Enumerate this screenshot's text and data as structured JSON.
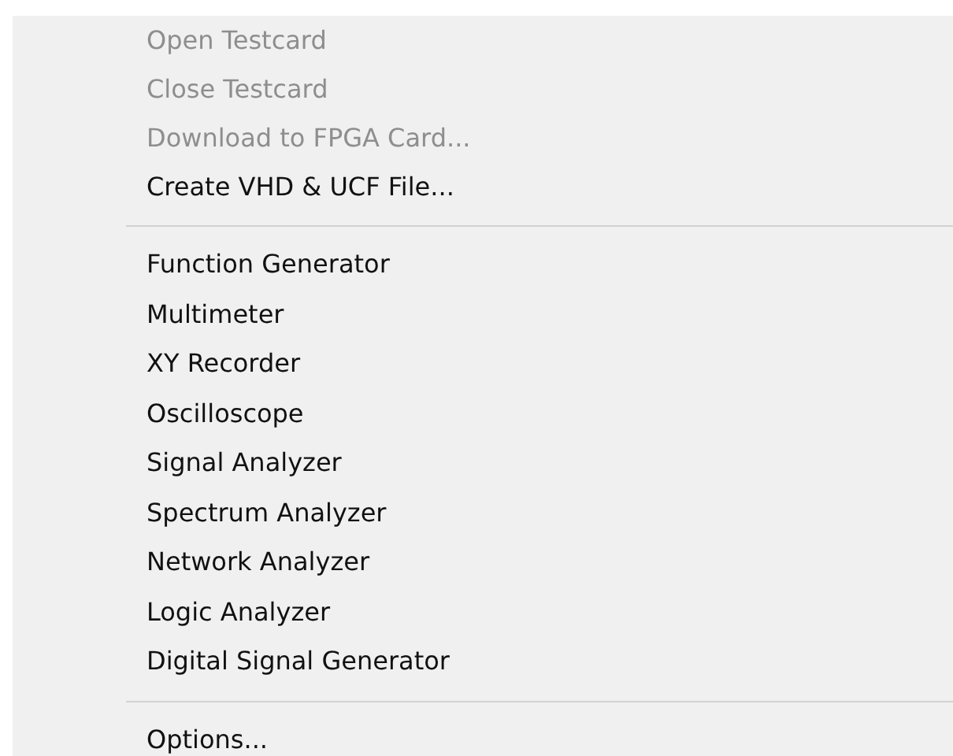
{
  "menu": {
    "groups": [
      {
        "items": [
          {
            "label": "Open Testcard",
            "disabled": true
          },
          {
            "label": "Close Testcard",
            "disabled": true
          },
          {
            "label": "Download to FPGA Card...",
            "disabled": true
          },
          {
            "label": "Create VHD & UCF File...",
            "disabled": false
          }
        ]
      },
      {
        "items": [
          {
            "label": "Function Generator",
            "disabled": false
          },
          {
            "label": "Multimeter",
            "disabled": false
          },
          {
            "label": "XY Recorder",
            "disabled": false
          },
          {
            "label": "Oscilloscope",
            "disabled": false
          },
          {
            "label": "Signal Analyzer",
            "disabled": false
          },
          {
            "label": "Spectrum Analyzer",
            "disabled": false
          },
          {
            "label": "Network Analyzer",
            "disabled": false
          },
          {
            "label": "Logic Analyzer",
            "disabled": false
          },
          {
            "label": "Digital Signal Generator",
            "disabled": false
          }
        ]
      },
      {
        "items": [
          {
            "label": "Options...",
            "disabled": false
          }
        ]
      }
    ]
  }
}
